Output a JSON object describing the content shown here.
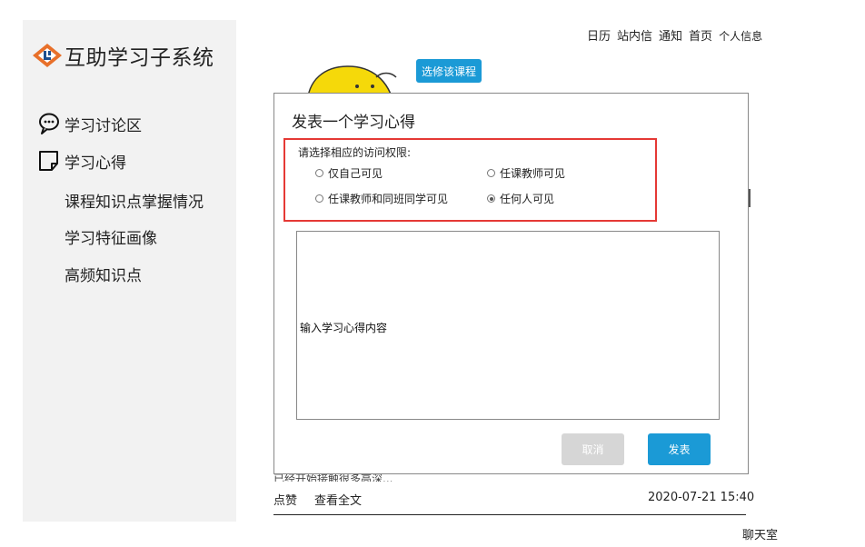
{
  "brand": {
    "name": "互助学习子系统",
    "logo_icon": "brand-logo-icon",
    "logo_color": "#e8702a"
  },
  "sidebar": {
    "items": [
      {
        "label": "学习讨论区",
        "icon": "speech-bubble-icon"
      },
      {
        "label": "学习心得",
        "icon": "note-icon"
      },
      {
        "label": "课程知识点掌握情况"
      },
      {
        "label": "学习特征画像"
      },
      {
        "label": "高频知识点"
      }
    ]
  },
  "topnav": {
    "items": [
      "日历",
      "站内信",
      "通知",
      "首页",
      "个人信息"
    ]
  },
  "course": {
    "enroll_label": "选修该课程",
    "accent": "#1b9ad6"
  },
  "post": {
    "excerpt": "已经开始接触很多高深...",
    "like_label": "点赞",
    "view_full_label": "查看全文",
    "timestamp": "2020-07-21 15:40"
  },
  "chatroom_label": "聊天室",
  "modal": {
    "title": "发表一个学习心得",
    "permission_prompt": "请选择相应的访问权限:",
    "options": [
      {
        "label": "仅自己可见",
        "checked": false
      },
      {
        "label": "任课教师可见",
        "checked": false
      },
      {
        "label": "任课教师和同班同学可见",
        "checked": false
      },
      {
        "label": "任何人可见",
        "checked": true
      }
    ],
    "content_placeholder": "输入学习心得内容",
    "cancel_label": "取消",
    "submit_label": "发表",
    "highlight_color": "#e53935"
  }
}
